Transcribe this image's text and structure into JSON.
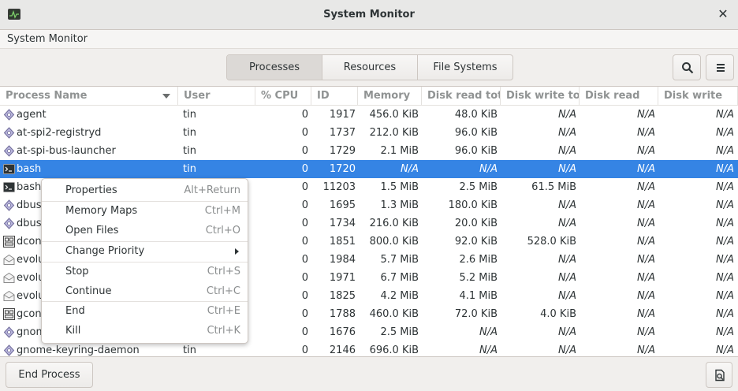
{
  "window": {
    "title": "System Monitor",
    "close_glyph": "✕"
  },
  "menubar": {
    "label": "System Monitor"
  },
  "tabs": [
    {
      "label": "Processes",
      "active": true
    },
    {
      "label": "Resources",
      "active": false
    },
    {
      "label": "File Systems",
      "active": false
    }
  ],
  "toolbar": {
    "search_icon": "search-icon",
    "menu_icon": "hamburger-menu-icon"
  },
  "table": {
    "columns": [
      "Process Name",
      "User",
      "% CPU",
      "ID",
      "Memory",
      "Disk read tot",
      "Disk write to",
      "Disk read",
      "Disk write"
    ],
    "rows": [
      {
        "name": "agent",
        "user": "tin",
        "cpu": "0",
        "id": "1917",
        "memory": "456.0 KiB",
        "disk_read_total": "48.0 KiB",
        "disk_write_total": "N/A",
        "disk_read": "N/A",
        "disk_write": "N/A",
        "icon": "gear-diamond"
      },
      {
        "name": "at-spi2-registryd",
        "user": "tin",
        "cpu": "0",
        "id": "1737",
        "memory": "212.0 KiB",
        "disk_read_total": "96.0 KiB",
        "disk_write_total": "N/A",
        "disk_read": "N/A",
        "disk_write": "N/A",
        "icon": "gear-diamond"
      },
      {
        "name": "at-spi-bus-launcher",
        "user": "tin",
        "cpu": "0",
        "id": "1729",
        "memory": "2.1 MiB",
        "disk_read_total": "96.0 KiB",
        "disk_write_total": "N/A",
        "disk_read": "N/A",
        "disk_write": "N/A",
        "icon": "gear-diamond"
      },
      {
        "name": "bash",
        "user": "tin",
        "cpu": "0",
        "id": "1720",
        "memory": "N/A",
        "disk_read_total": "N/A",
        "disk_write_total": "N/A",
        "disk_read": "N/A",
        "disk_write": "N/A",
        "icon": "terminal",
        "selected": true
      },
      {
        "name": "bash",
        "user": "",
        "cpu": "0",
        "id": "11203",
        "memory": "1.5 MiB",
        "disk_read_total": "2.5 MiB",
        "disk_write_total": "61.5 MiB",
        "disk_read": "N/A",
        "disk_write": "N/A",
        "icon": "terminal"
      },
      {
        "name": "dbus",
        "user": "",
        "cpu": "0",
        "id": "1695",
        "memory": "1.3 MiB",
        "disk_read_total": "180.0 KiB",
        "disk_write_total": "N/A",
        "disk_read": "N/A",
        "disk_write": "N/A",
        "icon": "gear-diamond"
      },
      {
        "name": "dbus",
        "user": "",
        "cpu": "0",
        "id": "1734",
        "memory": "216.0 KiB",
        "disk_read_total": "20.0 KiB",
        "disk_write_total": "N/A",
        "disk_read": "N/A",
        "disk_write": "N/A",
        "icon": "gear-diamond"
      },
      {
        "name": "dcon",
        "user": "",
        "cpu": "0",
        "id": "1851",
        "memory": "800.0 KiB",
        "disk_read_total": "92.0 KiB",
        "disk_write_total": "528.0 KiB",
        "disk_read": "N/A",
        "disk_write": "N/A",
        "icon": "config-box"
      },
      {
        "name": "evolu",
        "user": "",
        "cpu": "0",
        "id": "1984",
        "memory": "5.7 MiB",
        "disk_read_total": "2.6 MiB",
        "disk_write_total": "N/A",
        "disk_read": "N/A",
        "disk_write": "N/A",
        "icon": "envelope"
      },
      {
        "name": "evolu",
        "user": "",
        "cpu": "0",
        "id": "1971",
        "memory": "6.7 MiB",
        "disk_read_total": "5.2 MiB",
        "disk_write_total": "N/A",
        "disk_read": "N/A",
        "disk_write": "N/A",
        "icon": "envelope"
      },
      {
        "name": "evolu",
        "user": "",
        "cpu": "0",
        "id": "1825",
        "memory": "4.2 MiB",
        "disk_read_total": "4.1 MiB",
        "disk_write_total": "N/A",
        "disk_read": "N/A",
        "disk_write": "N/A",
        "icon": "envelope"
      },
      {
        "name": "gcon",
        "user": "",
        "cpu": "0",
        "id": "1788",
        "memory": "460.0 KiB",
        "disk_read_total": "72.0 KiB",
        "disk_write_total": "4.0 KiB",
        "disk_read": "N/A",
        "disk_write": "N/A",
        "icon": "config-box"
      },
      {
        "name": "gnom",
        "user": "",
        "cpu": "0",
        "id": "1676",
        "memory": "2.5 MiB",
        "disk_read_total": "N/A",
        "disk_write_total": "N/A",
        "disk_read": "N/A",
        "disk_write": "N/A",
        "icon": "gear-diamond"
      },
      {
        "name": "gnome-keyring-daemon",
        "user": "tin",
        "cpu": "0",
        "id": "2146",
        "memory": "696.0 KiB",
        "disk_read_total": "N/A",
        "disk_write_total": "N/A",
        "disk_read": "N/A",
        "disk_write": "N/A",
        "icon": "gear-diamond"
      }
    ]
  },
  "context_menu": {
    "items": [
      {
        "label": "Properties",
        "accel": "Alt+Return"
      },
      {
        "label": "Memory Maps",
        "accel": "Ctrl+M"
      },
      {
        "label": "Open Files",
        "accel": "Ctrl+O"
      },
      {
        "label": "Change Priority",
        "accel": "",
        "submenu": true
      },
      {
        "label": "Stop",
        "accel": "Ctrl+S"
      },
      {
        "label": "Continue",
        "accel": "Ctrl+C"
      },
      {
        "label": "End",
        "accel": "Ctrl+E"
      },
      {
        "label": "Kill",
        "accel": "Ctrl+K"
      }
    ]
  },
  "bottombar": {
    "end_process_label": "End Process",
    "corner_icon": "process-info-icon"
  },
  "colors": {
    "selection": "#3584e4",
    "header_text": "#909393",
    "accel_text": "#8b8e8f"
  }
}
